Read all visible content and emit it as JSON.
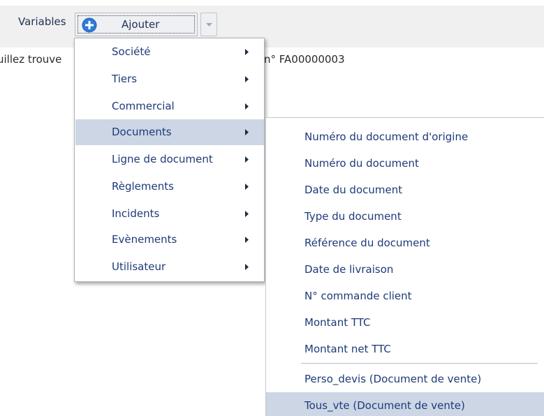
{
  "toolbar": {
    "variables_label": "Variables",
    "add_button_label": "Ajouter",
    "add_icon": "plus-circle-icon",
    "dropdown_icon": "caret-down-icon"
  },
  "body_text": {
    "left_fragment": "uillez trouve",
    "right_fragment": "n° FA00000003"
  },
  "menu": {
    "items": [
      {
        "label": "Société"
      },
      {
        "label": "Tiers"
      },
      {
        "label": "Commercial"
      },
      {
        "label": "Documents"
      },
      {
        "label": "Ligne de document"
      },
      {
        "label": "Règlements"
      },
      {
        "label": "Incidents"
      },
      {
        "label": "Evènements"
      },
      {
        "label": "Utilisateur"
      }
    ],
    "active_item": "Documents"
  },
  "submenu": {
    "items": [
      {
        "label": "Numéro du document d'origine"
      },
      {
        "label": "Numéro du document"
      },
      {
        "label": "Date du document"
      },
      {
        "label": "Type du document"
      },
      {
        "label": "Référence du document"
      },
      {
        "label": "Date de livraison"
      },
      {
        "label": "N° commande client"
      },
      {
        "label": "Montant TTC"
      },
      {
        "label": "Montant net TTC"
      },
      {
        "label": "Perso_devis (Document de vente)"
      },
      {
        "label": "Tous_vte (Document de vente)"
      }
    ],
    "active_item": "Tous_vte (Document de vente)"
  },
  "colors": {
    "text": "#1e3a78",
    "highlight": "#ccd6e5",
    "toolbar_bg": "#f0f0f0",
    "add_icon_blue": "#2f7ad8"
  }
}
